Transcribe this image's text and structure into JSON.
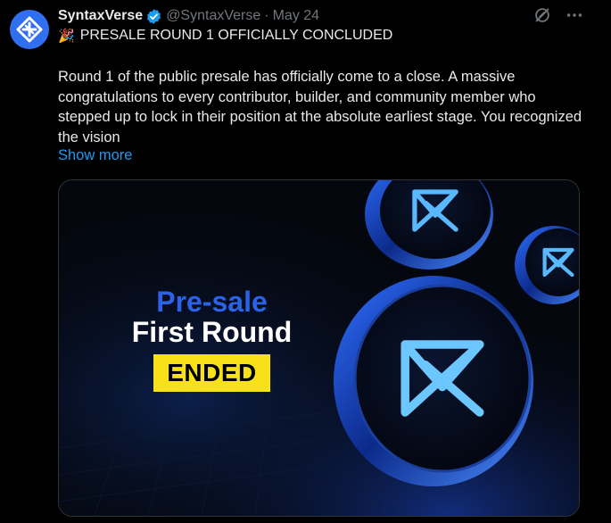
{
  "author": {
    "display_name": "SyntaxVerse",
    "handle": "@SyntaxVerse",
    "separator": "·",
    "date": "May 24",
    "verified": true
  },
  "headline": {
    "emoji": "🎉",
    "text": "PRESALE ROUND 1 OFFICIALLY CONCLUDED"
  },
  "body": "Round 1 of the public presale has officially come to a close. A massive congratulations to every contributor, builder, and community member who stepped up to lock in their position at the absolute earliest stage. You recognized the vision",
  "show_more": "Show more",
  "media": {
    "line1": "Pre-sale",
    "line2": "First Round",
    "badge": "ENDED"
  },
  "icons": {
    "avatar": "logo-icon",
    "verified": "verified-badge-icon",
    "grok": "grok-icon",
    "more": "more-icon"
  },
  "colors": {
    "background": "#000000",
    "link": "#1d9bf0",
    "verified": "#1d9bf0",
    "avatar": "#2f6ff0",
    "presale_blue": "#2b63e8",
    "ended_yellow": "#f8e119"
  }
}
